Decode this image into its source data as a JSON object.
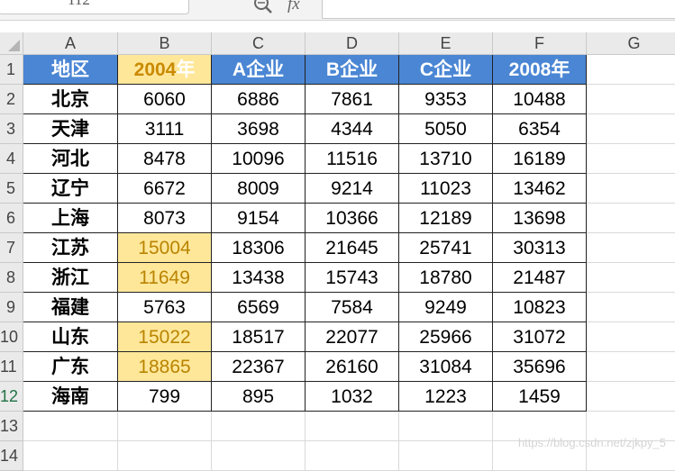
{
  "formula_bar": {
    "name_box": "112",
    "fx": "fx",
    "formula": ""
  },
  "columns": [
    "A",
    "B",
    "C",
    "D",
    "E",
    "F",
    "G"
  ],
  "rows": [
    "1",
    "2",
    "3",
    "4",
    "5",
    "6",
    "7",
    "8",
    "9",
    "10",
    "11",
    "12",
    "13",
    "14"
  ],
  "active_row": "12",
  "table": {
    "headers": [
      "地区",
      "2004年",
      "A企业",
      "B企业",
      "C企业",
      "2008年"
    ],
    "data": [
      [
        "北京",
        "6060",
        "6886",
        "7861",
        "9353",
        "10488"
      ],
      [
        "天津",
        "3111",
        "3698",
        "4344",
        "5050",
        "6354"
      ],
      [
        "河北",
        "8478",
        "10096",
        "11516",
        "13710",
        "16189"
      ],
      [
        "辽宁",
        "6672",
        "8009",
        "9214",
        "11023",
        "13462"
      ],
      [
        "上海",
        "8073",
        "9154",
        "10366",
        "12189",
        "13698"
      ],
      [
        "江苏",
        "15004",
        "18306",
        "21645",
        "25741",
        "30313"
      ],
      [
        "浙江",
        "11649",
        "13438",
        "15743",
        "18780",
        "21487"
      ],
      [
        "福建",
        "5763",
        "6569",
        "7584",
        "9249",
        "10823"
      ],
      [
        "山东",
        "15022",
        "18517",
        "22077",
        "25966",
        "31072"
      ],
      [
        "广东",
        "18865",
        "22367",
        "26160",
        "31084",
        "35696"
      ],
      [
        "海南",
        "799",
        "895",
        "1032",
        "1223",
        "1459"
      ]
    ],
    "highlighted_rows": [
      5,
      6,
      8,
      9
    ]
  },
  "colors": {
    "header_fill": "#4a86d4",
    "highlight_fill": "#ffe79a",
    "highlight_text": "#b98400"
  },
  "watermark": "https://blog.csdn.net/zjkpy_5"
}
